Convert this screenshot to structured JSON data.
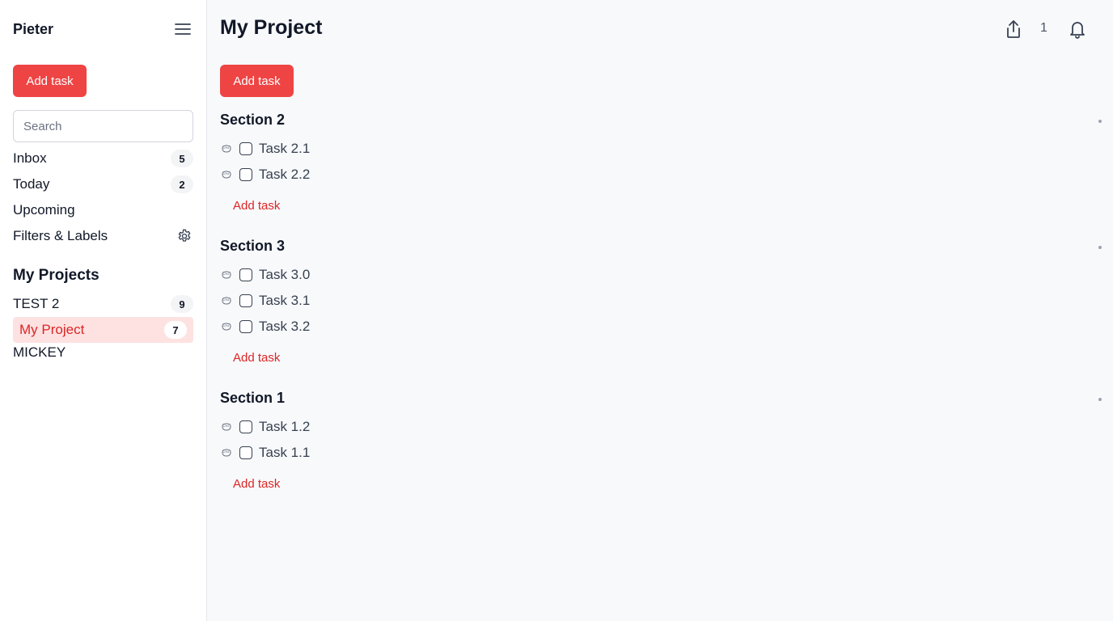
{
  "sidebar": {
    "user_name": "Pieter",
    "add_task_label": "Add task",
    "search_placeholder": "Search",
    "nav": [
      {
        "label": "Inbox",
        "count": "5"
      },
      {
        "label": "Today",
        "count": "2"
      },
      {
        "label": "Upcoming"
      },
      {
        "label": "Filters & Labels",
        "icon": "gear-icon"
      }
    ],
    "projects_title": "My Projects",
    "projects": [
      {
        "label": "TEST 2",
        "count": "9"
      },
      {
        "label": "My Project",
        "count": "7",
        "active": true
      },
      {
        "label": "MICKEY"
      }
    ]
  },
  "header": {
    "title": "My Project",
    "share_icon": "share-icon",
    "notification_count": "1",
    "bell_icon": "bell-icon"
  },
  "main": {
    "add_task_label": "Add task",
    "sections": [
      {
        "title": "Section 2",
        "tasks": [
          "Task 2.1",
          "Task 2.2"
        ],
        "add_label": "Add task"
      },
      {
        "title": "Section 3",
        "tasks": [
          "Task 3.0",
          "Task 3.1",
          "Task 3.2"
        ],
        "add_label": "Add task"
      },
      {
        "title": "Section 1",
        "tasks": [
          "Task 1.2",
          "Task 1.1"
        ],
        "add_label": "Add task"
      }
    ]
  },
  "colors": {
    "accent": "#ef4444",
    "active_bg": "#fee2e2",
    "active_text": "#dc2626"
  }
}
